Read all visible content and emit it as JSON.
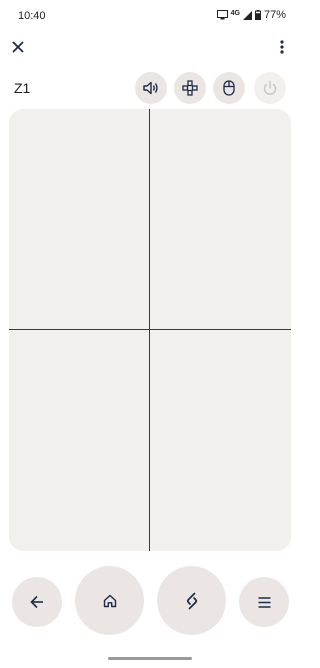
{
  "status_bar": {
    "time": "10:40",
    "network": "4G",
    "battery": "77%"
  },
  "header": {
    "close_icon": "close-icon",
    "more_icon": "more-vert-icon",
    "device_name": "Z1"
  },
  "mode_buttons": [
    {
      "icon": "volume-icon",
      "enabled": true
    },
    {
      "icon": "gamepad-icon",
      "enabled": true
    },
    {
      "icon": "mouse-icon",
      "enabled": true
    },
    {
      "icon": "power-icon",
      "enabled": false
    }
  ],
  "touchpad": {
    "grid": "2x2"
  },
  "bottom_nav": [
    {
      "icon": "back-arrow-icon"
    },
    {
      "icon": "home-icon"
    },
    {
      "icon": "switch-icon"
    },
    {
      "icon": "menu-icon"
    }
  ],
  "colors": {
    "button_bg": "#ebe6e3",
    "touchpad_bg": "#f2f0ed",
    "icon": "#1f2a44"
  }
}
